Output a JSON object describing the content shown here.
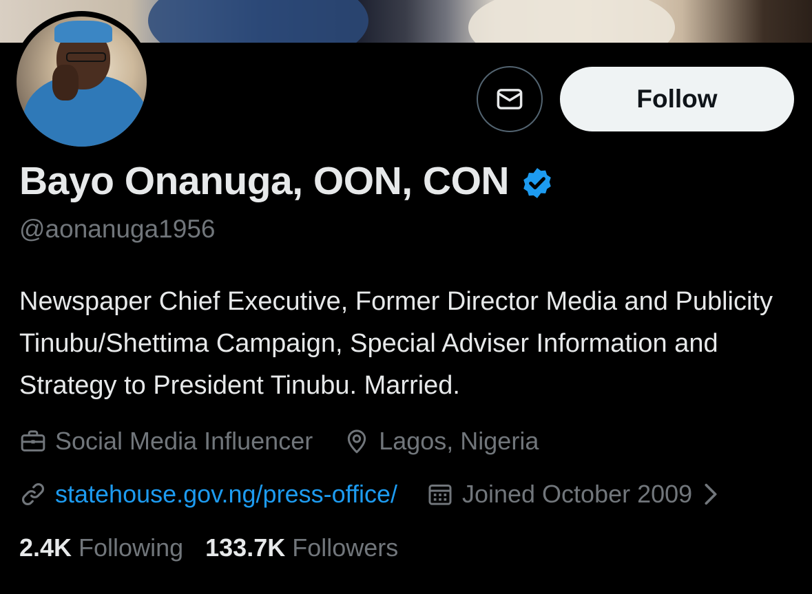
{
  "colors": {
    "background": "#000000",
    "primary_text": "#e7e9ea",
    "secondary_text": "#71767b",
    "link": "#1d9bf0",
    "verified_badge": "#1d9bf0",
    "follow_button_bg": "#eff3f4",
    "follow_button_text": "#0f1419"
  },
  "profile": {
    "display_name": "Bayo Onanuga, OON, CON",
    "handle": "@aonanuga1956",
    "verified": true,
    "bio": "Newspaper Chief Executive, Former Director Media and Publicity Tinubu/Shettima Campaign, Special Adviser Information and Strategy to President Tinubu. Married."
  },
  "actions": {
    "message_icon": "envelope-icon",
    "follow_label": "Follow"
  },
  "meta": {
    "category": {
      "icon": "briefcase-icon",
      "text": "Social Media Influencer"
    },
    "location": {
      "icon": "location-pin-icon",
      "text": "Lagos, Nigeria"
    },
    "website": {
      "icon": "link-icon",
      "text": "statehouse.gov.ng/press-office/"
    },
    "joined": {
      "icon": "calendar-icon",
      "text": "Joined October 2009"
    },
    "more_icon": "chevron-right-icon"
  },
  "stats": {
    "following_count": "2.4K",
    "following_label": "Following",
    "followers_count": "133.7K",
    "followers_label": "Followers"
  }
}
